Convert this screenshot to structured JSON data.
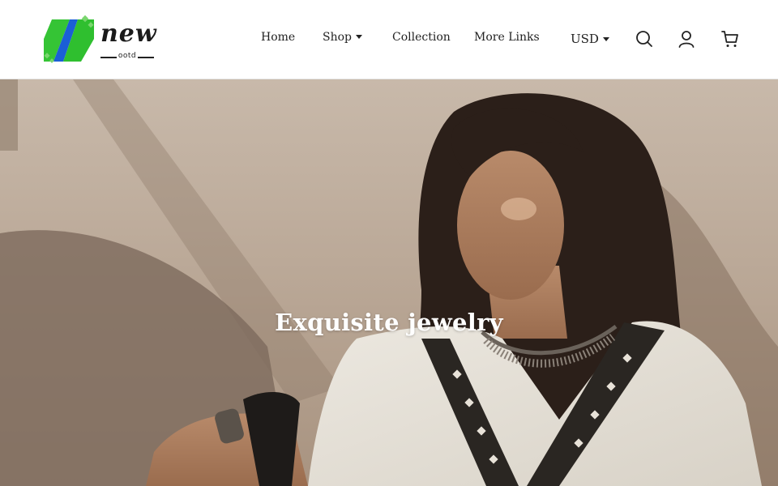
{
  "header": {
    "logo": {
      "word": "new",
      "sub": "ootd"
    },
    "nav": [
      {
        "label": "Home"
      },
      {
        "label": "Shop"
      },
      {
        "label": "Collection"
      },
      {
        "label": "More Links"
      }
    ],
    "currency": "USD",
    "icons": [
      "search-icon",
      "account-icon",
      "cart-icon"
    ]
  },
  "hero": {
    "title": "Exquisite jewelry"
  },
  "colors": {
    "logo_green": "#2fbf2f",
    "logo_blue": "#1b5fd6",
    "text": "#222222",
    "hero_text": "#ffffff"
  }
}
